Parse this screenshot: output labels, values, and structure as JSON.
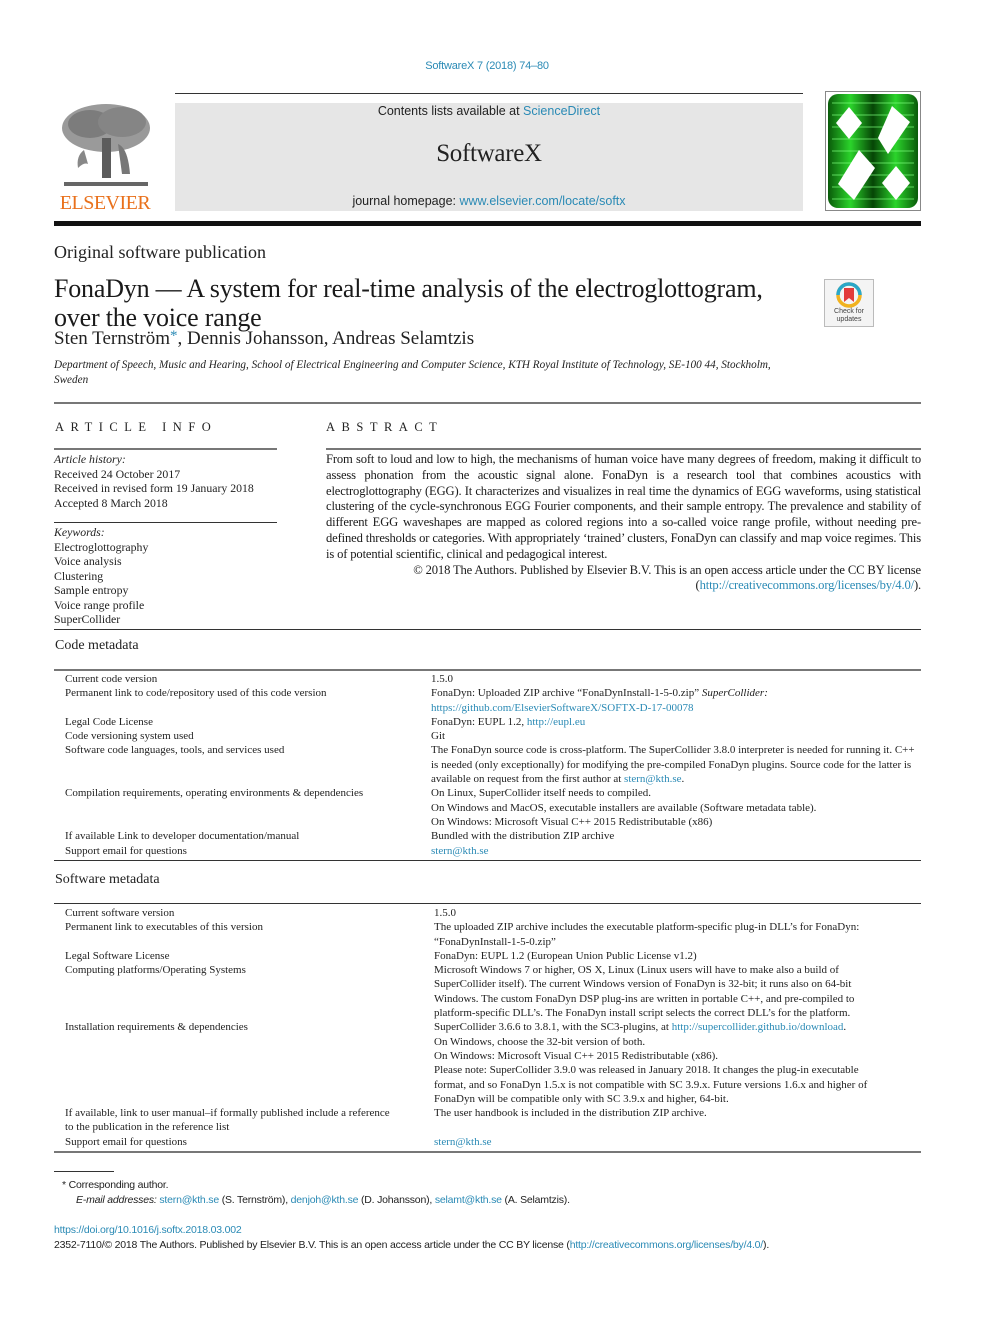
{
  "header": {
    "citation": "SoftwareX 7 (2018) 74–80",
    "contents_prefix": "Contents lists available at ",
    "contents_link": "ScienceDirect",
    "journal_name": "SoftwareX",
    "homepage_prefix": "journal homepage: ",
    "homepage_link": "www.elsevier.com/locate/softx",
    "publisher_logo_text": "ELSEVIER",
    "colors": {
      "link": "#2a8ab5",
      "elsevier_orange": "#e9711c",
      "masthead_bg": "#e6e6e6",
      "cover_green": "#1fa31f"
    }
  },
  "article": {
    "type": "Original software publication",
    "title": "FonaDyn —  A system for real-time analysis of the electroglottogram, over the voice range",
    "authors_before": "Sten Ternström",
    "corresponding_marker": "*",
    "authors_after": ", Dennis Johansson, Andreas Selamtzis",
    "affiliation": "Department of Speech, Music and Hearing, School of Electrical Engineering and Computer Science, KTH Royal Institute of Technology, SE-100 44, Stockholm, Sweden",
    "check_updates_label": "Check for updates"
  },
  "article_info": {
    "heading": "ARTICLE INFO",
    "history_label": "Article history:",
    "history": [
      "Received 24 October 2017",
      "Received in revised form 19 January 2018",
      "Accepted 8 March 2018"
    ],
    "keywords_label": "Keywords:",
    "keywords": [
      "Electroglottography",
      "Voice analysis",
      "Clustering",
      "Sample entropy",
      "Voice range profile",
      "SuperCollider"
    ]
  },
  "abstract": {
    "heading": "ABSTRACT",
    "body": "From soft to loud and low to high, the mechanisms of human voice have many degrees of freedom, making it difficult to assess phonation from the acoustic signal alone. FonaDyn is a research tool that combines acoustics with electroglottography (EGG). It characterizes and visualizes in real time the dynamics of EGG waveforms, using statistical clustering of the cycle-synchronous EGG Fourier components, and their sample entropy. The prevalence and stability of different EGG waveshapes are mapped as colored regions into a so-called voice range profile, without needing pre-defined thresholds or categories. With appropriately ‘trained’ clusters, FonaDyn can classify and map voice regimes. This is of potential scientific, clinical and pedagogical interest.",
    "copyright": "© 2018 The Authors. Published by Elsevier B.V. This is an open access article under the CC BY license (",
    "license_link": "http://creativecommons.org/licenses/by/4.0/",
    "copyright_end": ")."
  },
  "code_metadata": {
    "title": "Code metadata",
    "rows": [
      {
        "key": "Current code version",
        "value": "1.5.0"
      },
      {
        "key": "Permanent link to code/repository used of this code version",
        "value": "FonaDyn: Uploaded ZIP archive “FonaDynInstall-1-5-0.zip” ",
        "value_italic": "SuperCollider:",
        "link": "https://github.com/ElsevierSoftwareX/SOFTX-D-17-00078"
      },
      {
        "key": "Legal Code License",
        "value": "FonaDyn: EUPL 1.2, ",
        "link": "http://eupl.eu"
      },
      {
        "key": "Code versioning system used",
        "value": "Git"
      },
      {
        "key": "Software code languages, tools, and services used",
        "value": "The FonaDyn source code is cross-platform. The SuperCollider 3.8.0 interpreter is needed for running it. C++ is needed (only exceptionally) for modifying the pre-compiled FonaDyn plugins. Source code for the latter is available on request from the first author at ",
        "link": "stern@kth.se",
        "value_end": "."
      },
      {
        "key": "Compilation requirements, operating environments & dependencies",
        "lines": [
          "On Linux, SuperCollider itself needs to compiled.",
          "On Windows and MacOS, executable installers are available (Software metadata table).",
          "On Windows: Microsoft Visual C++ 2015 Redistributable (x86)"
        ]
      },
      {
        "key": "If available Link to developer documentation/manual",
        "value": "Bundled with the distribution ZIP archive"
      },
      {
        "key": "Support email for questions",
        "link": "stern@kth.se"
      }
    ]
  },
  "software_metadata": {
    "title": "Software metadata",
    "rows": [
      {
        "key": "Current software version",
        "value": "1.5.0"
      },
      {
        "key": "Permanent link to executables of this version",
        "value": "The uploaded ZIP archive includes the executable platform-specific plug-in DLL’s for FonaDyn: “FonaDynInstall-1-5-0.zip”"
      },
      {
        "key": "Legal Software License",
        "value": "FonaDyn: EUPL 1.2 (European Union Public License v1.2)"
      },
      {
        "key": "Computing platforms/Operating Systems",
        "value": "Microsoft Windows 7 or higher, OS X, Linux (Linux users will have to make also a build of SuperCollider itself). The current Windows version of FonaDyn is 32-bit; it runs also on 64-bit Windows. The custom FonaDyn DSP plug-ins are written in portable C++, and pre-compiled to platform-specific DLL’s. The FonaDyn install script selects the correct DLL’s for the platform."
      },
      {
        "key": "Installation requirements & dependencies",
        "value": "SuperCollider 3.6.6 to 3.8.1, with the SC3-plugins, at ",
        "link": "http://supercollider.github.io/download",
        "value_end": ".",
        "lines": [
          "On Windows, choose the 32-bit version of both.",
          "On Windows: Microsoft Visual C++ 2015 Redistributable (x86).",
          "Please note: SuperCollider 3.9.0 was released in January 2018. It changes the plug-in executable format, and so FonaDyn 1.5.x is not compatible with SC 3.9.x. Future versions 1.6.x and higher of FonaDyn will be compatible only with SC 3.9.x and higher, 64-bit."
        ]
      },
      {
        "key": "If available, link to user manual–if formally published include a reference to the publication in the reference list",
        "value": "The user handbook is included in the distribution ZIP archive."
      },
      {
        "key": "Support email for questions",
        "link": "stern@kth.se"
      }
    ]
  },
  "footer": {
    "footnote_marker": "*",
    "footnote_text": "Corresponding author.",
    "email_label": "E-mail addresses:",
    "emails": [
      {
        "address": "stern@kth.se",
        "name": " (S. Ternström), "
      },
      {
        "address": "denjoh@kth.se",
        "name": " (D. Johansson), "
      },
      {
        "address": "selamt@kth.se",
        "name": " (A. Selamtzis)."
      }
    ],
    "doi": "https://doi.org/10.1016/j.softx.2018.03.002",
    "issn_text": "2352-7110/© 2018 The Authors.  Published by Elsevier B.V. This is an open access article under the CC BY license (",
    "issn_link": "http://creativecommons.org/licenses/by/4.0/",
    "issn_end": ")."
  }
}
